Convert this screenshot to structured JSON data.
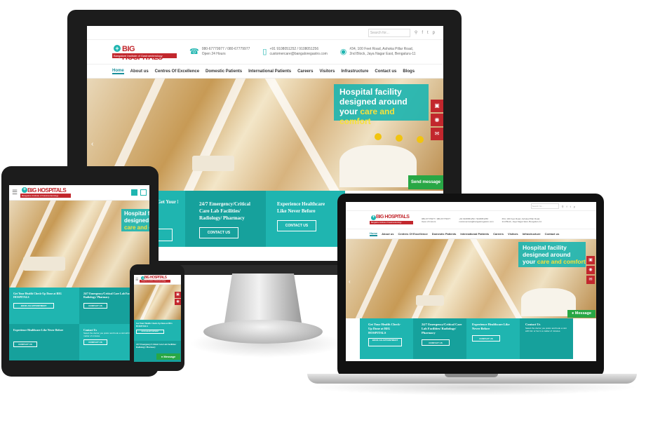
{
  "site": {
    "logo_title": "BIG HOSPITALS",
    "logo_subtitle": "Bangalore Institute of Gastroenterology",
    "search_placeholder": "Search for...",
    "phone": "080-67779977 / 080-67779977",
    "hours": "Open 24 Hours",
    "mobile": "+91 9108051252 / 9108051256",
    "email": "customercare@bangaloregastro.com",
    "address_line1": "#34, 100 Feet Road, Ashoka Pillar Road,",
    "address_line2": "2nd Block, Jaya Nagar East, Bengaluru-11",
    "nav": [
      "Home",
      "About us",
      "Centres Of Excellence",
      "Domestic Patients",
      "International Patients",
      "Careers",
      "Visitors",
      "Infrastructure",
      "Contact us",
      "Blogs"
    ],
    "hero_line1": "Hospital facility",
    "hero_line2": "designed around",
    "hero_line3_prefix": "your ",
    "hero_line3_highlight": "care and comfort",
    "send_message": "Send message",
    "message": "Message",
    "box1_title": "Get Your Health Check-Up Done at BIG HOSPITALS",
    "box1_button": "BOOK AN APPOINTMENT",
    "box2_title": "24/7 Emergency/Critical Care Lab Facilities/ Radiology/ Pharmacy",
    "box2_button": "CONTACT US",
    "box3_title": "Experience Healthcare Like Never Before",
    "box3_button": "CONTACT US",
    "box4_title": "Contact Us",
    "box4_text": "Select the doctor you prefer and book a visit with him or her in a matter of minutes."
  },
  "colors": {
    "teal": "#1fb5b0",
    "teal_dark": "#16a19c",
    "red": "#c2272d",
    "yellow": "#f7e13b",
    "green": "#28a745"
  },
  "icons": [
    "search-icon",
    "facebook-icon",
    "twitter-icon",
    "pinterest-icon",
    "phone-icon",
    "mobile-icon",
    "location-icon",
    "calendar-icon",
    "chat-icon",
    "mail-icon",
    "whatsapp-icon",
    "menu-icon"
  ]
}
